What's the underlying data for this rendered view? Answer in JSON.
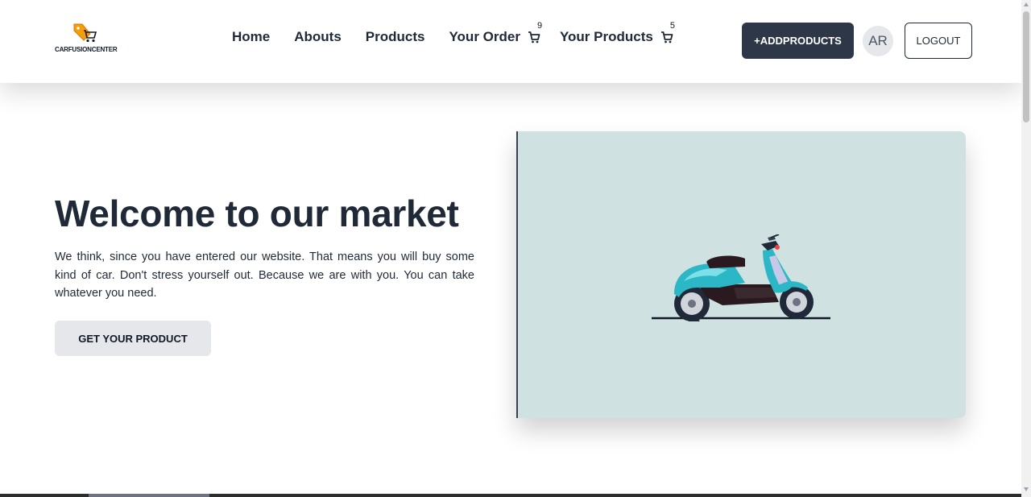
{
  "header": {
    "logo_text": "CARFUSIONCENTER",
    "nav": {
      "home": "Home",
      "abouts": "Abouts",
      "products": "Products",
      "your_order": "Your Order",
      "your_order_count": "9",
      "your_products": "Your Products",
      "your_products_count": "5"
    },
    "add_products_label": "+ADDPRODUCTS",
    "avatar_initials": "AR",
    "logout_label": "LOGOUT"
  },
  "hero": {
    "title": "Welcome to our market",
    "description": "We think, since you have entered our website. That means you will buy some kind of car. Don't stress yourself out. Because we are with you. You can take whatever you need.",
    "cta_label": "GET YOUR PRODUCT",
    "image_icon": "scooter-illustration"
  },
  "colors": {
    "primary_dark": "#2d3748",
    "hero_image_bg": "#cfe2e1",
    "scooter_teal": "#2bb7c5",
    "logo_orange": "#f59e0b"
  }
}
